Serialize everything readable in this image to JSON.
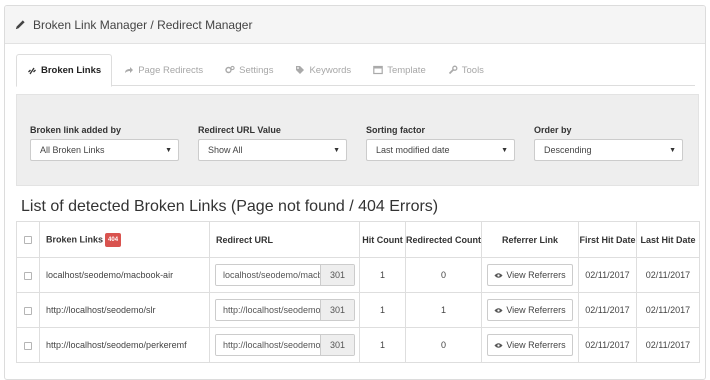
{
  "header": {
    "title": "Broken Link Manager / Redirect Manager",
    "icon": "pencil-icon"
  },
  "tabs": [
    {
      "label": "Broken Links",
      "icon": "chain-broken-icon",
      "active": true
    },
    {
      "label": "Page Redirects",
      "icon": "share-icon",
      "active": false
    },
    {
      "label": "Settings",
      "icon": "gears-icon",
      "active": false
    },
    {
      "label": "Keywords",
      "icon": "tag-icon",
      "active": false
    },
    {
      "label": "Template",
      "icon": "window-icon",
      "active": false
    },
    {
      "label": "Tools",
      "icon": "wrench-icon",
      "active": false
    }
  ],
  "filters": [
    {
      "label": "Broken link added by",
      "value": "All Broken Links"
    },
    {
      "label": "Redirect URL Value",
      "value": "Show All"
    },
    {
      "label": "Sorting factor",
      "value": "Last modified date"
    },
    {
      "label": "Order by",
      "value": "Descending"
    }
  ],
  "list": {
    "title": "List of detected Broken Links (Page not found / 404 Errors)",
    "columns": {
      "broken_links": "Broken Links",
      "badge": "404",
      "redirect_url": "Redirect URL",
      "hit_count": "Hit Count",
      "redirected_count": "Redirected Count",
      "referrer_link": "Referrer Link",
      "first_hit_date": "First Hit Date",
      "last_hit_date": "Last Hit Date"
    },
    "rows": [
      {
        "broken_link": "localhost/seodemo/macbook-air",
        "redirect_url": "localhost/seodemo/macbook-air",
        "redirect_code": "301",
        "hit_count": "1",
        "redirected_count": "0",
        "referrer_button": "View Referrers",
        "first_hit": "02/11/2017",
        "last_hit": "02/11/2017"
      },
      {
        "broken_link": "http://localhost/seodemo/slr",
        "redirect_url": "http://localhost/seodemo/slr",
        "redirect_code": "301",
        "hit_count": "1",
        "redirected_count": "1",
        "referrer_button": "View Referrers",
        "first_hit": "02/11/2017",
        "last_hit": "02/11/2017"
      },
      {
        "broken_link": "http://localhost/seodemo/perkeremf",
        "redirect_url": "http://localhost/seodemo/perkeremf",
        "redirect_code": "301",
        "hit_count": "1",
        "redirected_count": "0",
        "referrer_button": "View Referrers",
        "first_hit": "02/11/2017",
        "last_hit": "02/11/2017"
      }
    ]
  }
}
